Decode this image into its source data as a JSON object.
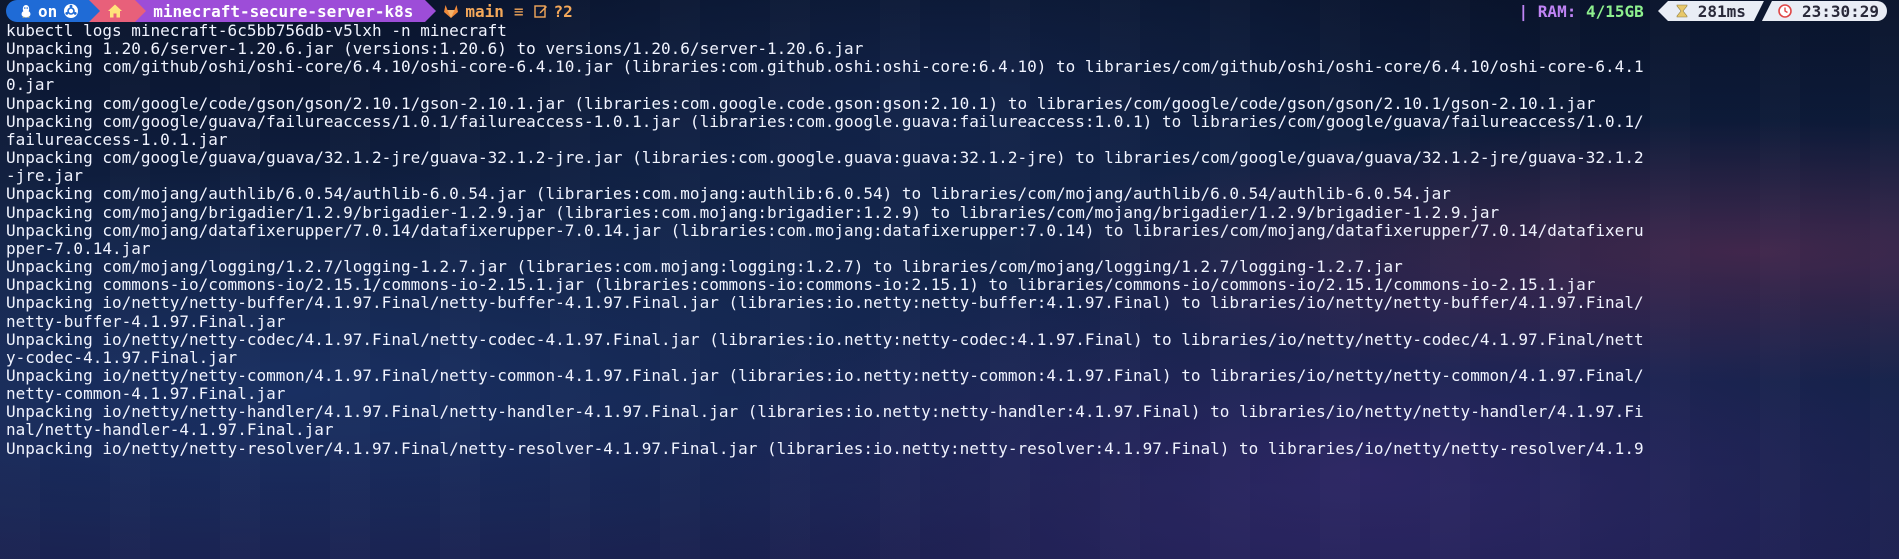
{
  "prompt": {
    "os_label": "on",
    "directory": "minecraft-secure-server-k8s",
    "git_branch": "main",
    "git_separator": "≡",
    "git_status": "?2"
  },
  "status": {
    "ram_label": "RAM:",
    "ram_value": "4/15GB",
    "separator": "|",
    "duration": "281ms",
    "clock": "23:30:29"
  },
  "command": "kubectl logs minecraft-6c5bb756db-v5lxh -n minecraft",
  "log_lines": [
    "Unpacking 1.20.6/server-1.20.6.jar (versions:1.20.6) to versions/1.20.6/server-1.20.6.jar",
    "Unpacking com/github/oshi/oshi-core/6.4.10/oshi-core-6.4.10.jar (libraries:com.github.oshi:oshi-core:6.4.10) to libraries/com/github/oshi/oshi-core/6.4.10/oshi-core-6.4.1",
    "0.jar",
    "Unpacking com/google/code/gson/gson/2.10.1/gson-2.10.1.jar (libraries:com.google.code.gson:gson:2.10.1) to libraries/com/google/code/gson/gson/2.10.1/gson-2.10.1.jar",
    "Unpacking com/google/guava/failureaccess/1.0.1/failureaccess-1.0.1.jar (libraries:com.google.guava:failureaccess:1.0.1) to libraries/com/google/guava/failureaccess/1.0.1/",
    "failureaccess-1.0.1.jar",
    "Unpacking com/google/guava/guava/32.1.2-jre/guava-32.1.2-jre.jar (libraries:com.google.guava:guava:32.1.2-jre) to libraries/com/google/guava/guava/32.1.2-jre/guava-32.1.2",
    "-jre.jar",
    "Unpacking com/mojang/authlib/6.0.54/authlib-6.0.54.jar (libraries:com.mojang:authlib:6.0.54) to libraries/com/mojang/authlib/6.0.54/authlib-6.0.54.jar",
    "Unpacking com/mojang/brigadier/1.2.9/brigadier-1.2.9.jar (libraries:com.mojang:brigadier:1.2.9) to libraries/com/mojang/brigadier/1.2.9/brigadier-1.2.9.jar",
    "Unpacking com/mojang/datafixerupper/7.0.14/datafixerupper-7.0.14.jar (libraries:com.mojang:datafixerupper:7.0.14) to libraries/com/mojang/datafixerupper/7.0.14/datafixeru",
    "pper-7.0.14.jar",
    "Unpacking com/mojang/logging/1.2.7/logging-1.2.7.jar (libraries:com.mojang:logging:1.2.7) to libraries/com/mojang/logging/1.2.7/logging-1.2.7.jar",
    "Unpacking commons-io/commons-io/2.15.1/commons-io-2.15.1.jar (libraries:commons-io:commons-io:2.15.1) to libraries/commons-io/commons-io/2.15.1/commons-io-2.15.1.jar",
    "Unpacking io/netty/netty-buffer/4.1.97.Final/netty-buffer-4.1.97.Final.jar (libraries:io.netty:netty-buffer:4.1.97.Final) to libraries/io/netty/netty-buffer/4.1.97.Final/",
    "netty-buffer-4.1.97.Final.jar",
    "Unpacking io/netty/netty-codec/4.1.97.Final/netty-codec-4.1.97.Final.jar (libraries:io.netty:netty-codec:4.1.97.Final) to libraries/io/netty/netty-codec/4.1.97.Final/nett",
    "y-codec-4.1.97.Final.jar",
    "Unpacking io/netty/netty-common/4.1.97.Final/netty-common-4.1.97.Final.jar (libraries:io.netty:netty-common:4.1.97.Final) to libraries/io/netty/netty-common/4.1.97.Final/",
    "netty-common-4.1.97.Final.jar",
    "Unpacking io/netty/netty-handler/4.1.97.Final/netty-handler-4.1.97.Final.jar (libraries:io.netty:netty-handler:4.1.97.Final) to libraries/io/netty/netty-handler/4.1.97.Fi",
    "nal/netty-handler-4.1.97.Final.jar",
    "Unpacking io/netty/netty-resolver/4.1.97.Final/netty-resolver-4.1.97.Final.jar (libraries:io.netty:netty-resolver:4.1.97.Final) to libraries/io/netty/netty-resolver/4.1.9"
  ],
  "icons": {
    "os": "linux-tux-icon",
    "os_badge": "ubuntu-circle-icon",
    "home": "house-icon",
    "git_provider": "gitlab-fox-icon",
    "git_edit": "edit-icon",
    "duration": "hourglass-icon",
    "clock": "clock-icon"
  },
  "colors": {
    "os_segment": "#1f6bd6",
    "home_segment": "#e8607a",
    "dir_segment": "#9d4dd8",
    "git_text": "#f4a85a",
    "ram_label": "#c084f5",
    "ram_value": "#8ef08e",
    "pill_bg": "#e9edf5",
    "log_text": "#f1f4ff"
  }
}
